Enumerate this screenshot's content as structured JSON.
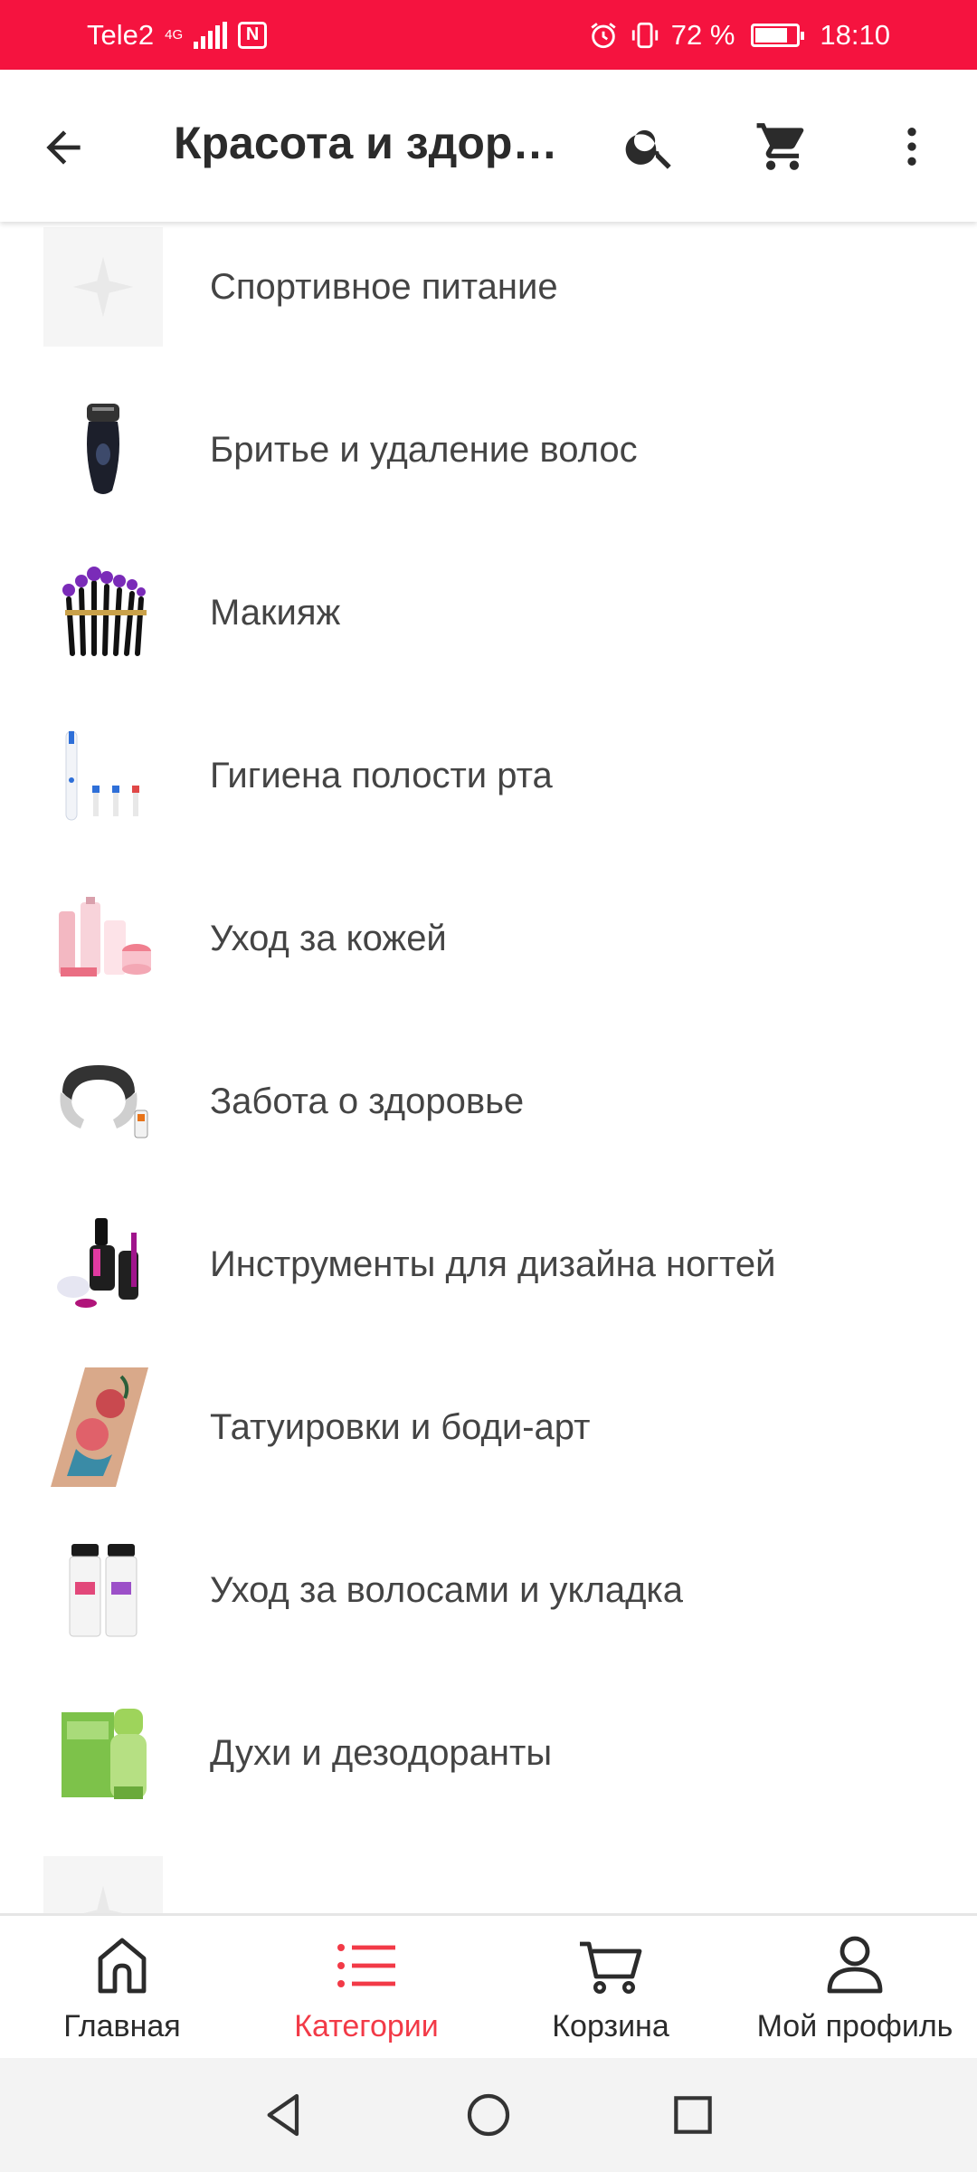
{
  "status_bar": {
    "carrier": "Tele2",
    "network": "4G",
    "battery": "72 %",
    "time": "18:10"
  },
  "header": {
    "title": "Красота и здоровье",
    "back_icon": "back-arrow-icon",
    "search_icon": "search-icon",
    "cart_icon": "cart-icon",
    "more_icon": "more-vert-icon"
  },
  "categories": [
    {
      "label": "Спортивное питание",
      "icon": "placeholder-star-icon"
    },
    {
      "label": "Бритье и удаление волос",
      "icon": "shaver-icon"
    },
    {
      "label": "Макияж",
      "icon": "makeup-brushes-icon"
    },
    {
      "label": "Гигиена полости рта",
      "icon": "toothbrush-icon"
    },
    {
      "label": "Уход за кожей",
      "icon": "skincare-icon"
    },
    {
      "label": "Забота о здоровье",
      "icon": "neck-massager-icon"
    },
    {
      "label": "Инструменты для дизайна ногтей",
      "icon": "nail-polish-icon"
    },
    {
      "label": "Татуировки и боди-арт",
      "icon": "tattoo-icon"
    },
    {
      "label": "Уход за волосами и укладка",
      "icon": "hair-care-icon"
    },
    {
      "label": "Духи и дезодоранты",
      "icon": "perfume-icon"
    },
    {
      "label": "",
      "icon": "placeholder-star-icon"
    }
  ],
  "bottom_nav": [
    {
      "label": "Главная",
      "icon": "home-icon",
      "active": false
    },
    {
      "label": "Категории",
      "icon": "list-icon",
      "active": true
    },
    {
      "label": "Корзина",
      "icon": "cart-icon",
      "active": false
    },
    {
      "label": "Мой профиль",
      "icon": "profile-icon",
      "active": false
    }
  ],
  "colors": {
    "status_bar": "#f5133f",
    "accent": "#f23a47",
    "text": "#2b2b2b"
  }
}
